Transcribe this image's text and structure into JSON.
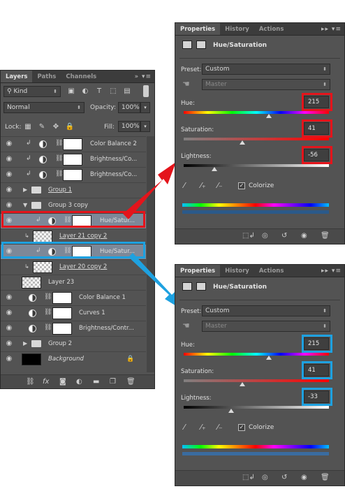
{
  "colors": {
    "red": "#e4141b",
    "blue": "#1ea1e0",
    "panel": "#535353",
    "selected": "#7d8898"
  },
  "layers_panel": {
    "tabs": [
      "Layers",
      "Paths",
      "Channels"
    ],
    "menu_glyph": "»",
    "filter_kind": "Kind",
    "blend_mode": "Normal",
    "opacity_label": "Opacity:",
    "opacity_value": "100%",
    "lock_label": "Lock:",
    "fill_label": "Fill:",
    "fill_value": "100%",
    "layers": [
      {
        "name": "Color Balance 2",
        "kind": "adjustment",
        "clipped": true
      },
      {
        "name": "Brightness/Co...",
        "kind": "adjustment",
        "clipped": true
      },
      {
        "name": "Brightness/Co...",
        "kind": "adjustment",
        "clipped": true
      },
      {
        "name": "Group 1",
        "kind": "group",
        "expanded": false
      },
      {
        "name": "Group 3 copy",
        "kind": "group",
        "expanded": true
      },
      {
        "name": "Hue/Satur...",
        "kind": "adjustment",
        "clipped": true,
        "selected": true,
        "highlight": "red"
      },
      {
        "name": "Layer 21 copy 2",
        "kind": "pixel"
      },
      {
        "name": "Hue/Satur...",
        "kind": "adjustment",
        "clipped": true,
        "selected": true,
        "highlight": "blue"
      },
      {
        "name": "Layer 20 copy 2",
        "kind": "pixel"
      },
      {
        "name": "Layer 23",
        "kind": "pixel"
      },
      {
        "name": "Color Balance 1",
        "kind": "adjustment"
      },
      {
        "name": "Curves 1",
        "kind": "adjustment"
      },
      {
        "name": "Brightness/Contr...",
        "kind": "adjustment"
      },
      {
        "name": "Group 2",
        "kind": "group",
        "expanded": false
      },
      {
        "name": "Background",
        "kind": "background",
        "locked": true
      }
    ],
    "footer_icons": [
      "link-icon",
      "fx-icon",
      "mask-icon",
      "adjustment-icon",
      "folder-icon",
      "new-layer-icon",
      "trash-icon"
    ]
  },
  "properties_top": {
    "tabs": [
      "Properties",
      "History",
      "Actions"
    ],
    "title": "Hue/Saturation",
    "preset_label": "Preset:",
    "preset_value": "Custom",
    "channel_value": "Master",
    "hue_label": "Hue:",
    "hue_value": "215",
    "saturation_label": "Saturation:",
    "saturation_value": "41",
    "lightness_label": "Lightness:",
    "lightness_value": "-56",
    "colorize_label": "Colorize",
    "colorize_checked": true
  },
  "properties_bottom": {
    "tabs": [
      "Properties",
      "History",
      "Actions"
    ],
    "title": "Hue/Saturation",
    "preset_label": "Preset:",
    "preset_value": "Custom",
    "channel_value": "Master",
    "hue_label": "Hue:",
    "hue_value": "215",
    "saturation_label": "Saturation:",
    "saturation_value": "41",
    "lightness_label": "Lightness:",
    "lightness_value": "-33",
    "colorize_label": "Colorize",
    "colorize_checked": true
  }
}
